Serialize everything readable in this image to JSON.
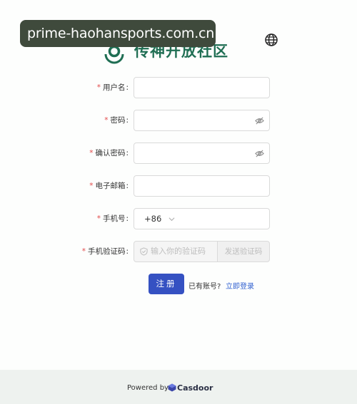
{
  "overlay": {
    "url": "prime-haohansports.com.cn"
  },
  "brand": {
    "name": "传神开放社区",
    "color": "#1f6e53"
  },
  "icons": {
    "language": "globe-icon",
    "password_toggle": "eye-invisible-icon",
    "code_prefix": "shield-icon",
    "country_dropdown": "chevron-down-icon"
  },
  "form": {
    "required_mark": "*",
    "colon": ":",
    "username": {
      "label": "用户名",
      "value": ""
    },
    "password": {
      "label": "密码",
      "value": ""
    },
    "confirm_password": {
      "label": "确认密码",
      "value": ""
    },
    "email": {
      "label": "电子邮箱",
      "value": ""
    },
    "phone": {
      "label": "手机号",
      "country_code": "+86",
      "value": ""
    },
    "verification": {
      "label": "手机验证码",
      "placeholder": "输入你的验证码",
      "send_label": "发送验证码"
    },
    "submit_label": "注册",
    "have_account_text": "已有账号?",
    "login_link": "立即登录"
  },
  "colors": {
    "primary": "#3551c2",
    "required": "#e34b4b",
    "link": "#2f5fd0"
  },
  "footer": {
    "powered_by": "Powered by",
    "product": "Casdoor"
  }
}
